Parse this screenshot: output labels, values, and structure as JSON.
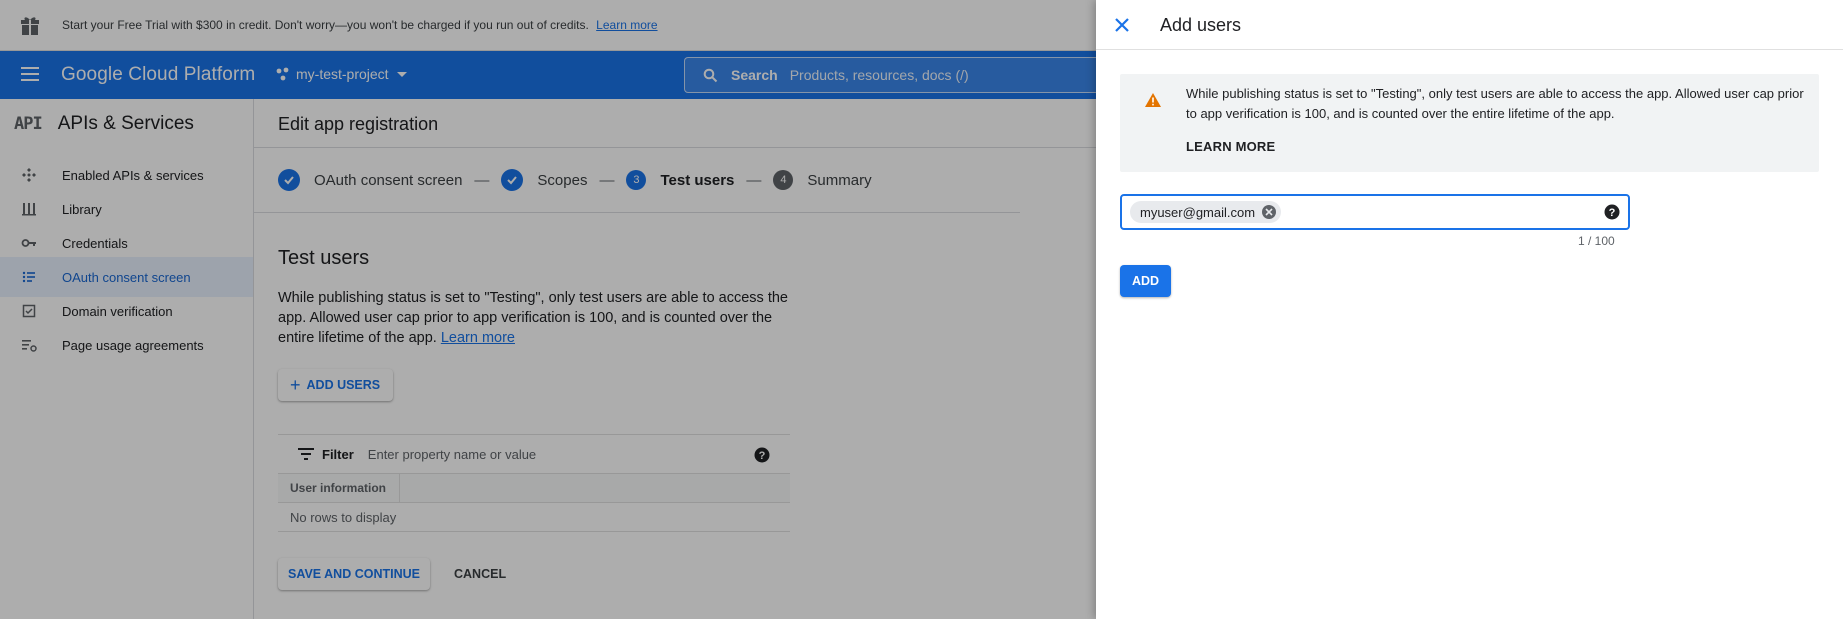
{
  "banner": {
    "text": "Start your Free Trial with $300 in credit. Don't worry—you won't be charged if you run out of credits.",
    "link": "Learn more"
  },
  "topbar": {
    "brand": "Google Cloud Platform",
    "project": "my-test-project",
    "search_label": "Search",
    "search_placeholder": "Products, resources, docs (/)"
  },
  "sidebar": {
    "title": "APIs & Services",
    "glyph": "API",
    "items": [
      {
        "label": "Enabled APIs & services",
        "icon": "enabled-apis-icon"
      },
      {
        "label": "Library",
        "icon": "library-icon"
      },
      {
        "label": "Credentials",
        "icon": "key-icon"
      },
      {
        "label": "OAuth consent screen",
        "icon": "consent-icon",
        "active": true
      },
      {
        "label": "Domain verification",
        "icon": "domain-check-icon"
      },
      {
        "label": "Page usage agreements",
        "icon": "settings-list-icon"
      }
    ]
  },
  "main": {
    "page_title": "Edit app registration",
    "steps": [
      {
        "label": "OAuth consent screen",
        "state": "done"
      },
      {
        "label": "Scopes",
        "state": "done"
      },
      {
        "number": "3",
        "label": "Test users",
        "state": "current"
      },
      {
        "number": "4",
        "label": "Summary",
        "state": "upcoming"
      }
    ],
    "section_title": "Test users",
    "section_desc": "While publishing status is set to \"Testing\", only test users are able to access the app. Allowed user cap prior to app verification is 100, and is counted over the entire lifetime of the app.",
    "section_link": "Learn more",
    "add_users_label": "ADD USERS",
    "filter_label": "Filter",
    "filter_placeholder": "Enter property name or value",
    "table_column": "User information",
    "table_empty": "No rows to display",
    "save_label": "SAVE AND CONTINUE",
    "cancel_label": "CANCEL"
  },
  "panel": {
    "title": "Add users",
    "notice_text": "While publishing status is set to \"Testing\", only test users are able to access the app. Allowed user cap prior to app verification is 100, and is counted over the entire lifetime of the app.",
    "notice_link": "LEARN MORE",
    "email_chip": "myuser@gmail.com",
    "counter": "1 / 100",
    "add_label": "ADD"
  },
  "colors": {
    "accent": "#1a73e8",
    "warning": "#e37400",
    "active_bg": "#e8f0fe"
  }
}
